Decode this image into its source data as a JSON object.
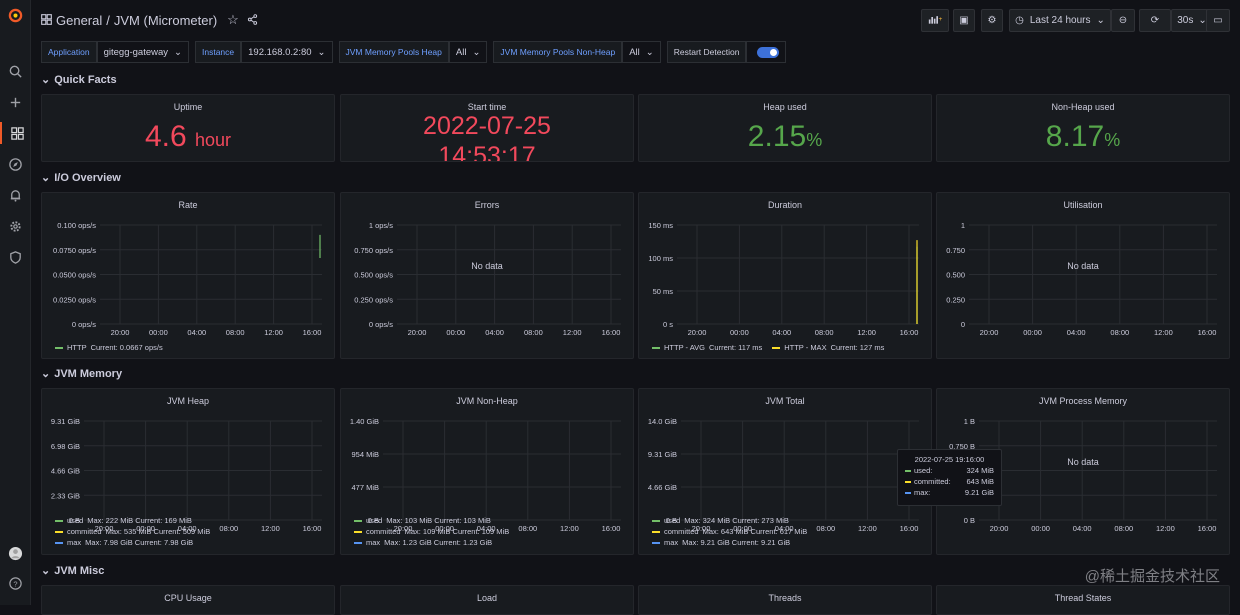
{
  "colors": {
    "green": "#73bf69",
    "yellow": "#fade2a",
    "cyan": "#5794f2",
    "red": "#f2495c",
    "stat_green": "#56a64b",
    "accent": "#f05a28"
  },
  "sidenav": {
    "items": [
      {
        "icon": "grafana-logo-icon"
      },
      {
        "icon": "search-icon"
      },
      {
        "icon": "plus-icon"
      },
      {
        "icon": "dashboards-icon",
        "active": true
      },
      {
        "icon": "explore-compass-icon"
      },
      {
        "icon": "alerting-bell-icon"
      },
      {
        "icon": "configuration-gear-icon"
      },
      {
        "icon": "shield-icon"
      },
      {
        "icon": "user-avatar-icon"
      },
      {
        "icon": "help-icon"
      }
    ]
  },
  "breadcrumb": {
    "folder": "General",
    "separator": "/",
    "dashboard": "JVM (Micrometer)"
  },
  "toolbar": {
    "time_range": "Last 24 hours",
    "refresh": "30s"
  },
  "variables": [
    {
      "label": "Application",
      "value": "gitegg-gateway",
      "dropdown": true
    },
    {
      "label": "Instance",
      "value": "192.168.0.2:80",
      "dropdown": true
    },
    {
      "label": "JVM Memory Pools Heap",
      "value": "All",
      "dropdown": true
    },
    {
      "label": "JVM Memory Pools Non-Heap",
      "value": "All",
      "dropdown": true
    },
    {
      "label": "Restart Detection",
      "value": "",
      "toggle": true
    }
  ],
  "rows": {
    "quick_facts": "Quick Facts",
    "io_overview": "I/O Overview",
    "jvm_memory": "JVM Memory",
    "jvm_misc": "JVM Misc"
  },
  "stats": {
    "uptime": {
      "title": "Uptime",
      "value": "4.6",
      "unit": "hour"
    },
    "start_time": {
      "title": "Start time",
      "line1": "2022-07-25",
      "line2": "14:53:17"
    },
    "heap_used": {
      "title": "Heap used",
      "value": "2.15",
      "unit": "%"
    },
    "nonheap_used": {
      "title": "Non-Heap used",
      "value": "8.17",
      "unit": "%"
    }
  },
  "x_ticks": [
    "20:00",
    "00:00",
    "04:00",
    "08:00",
    "12:00",
    "16:00"
  ],
  "no_data": "No data",
  "chart_data": [
    {
      "id": "rate",
      "type": "line",
      "title": "Rate",
      "y_ticks": [
        "0.100 ops/s",
        "0.0750 ops/s",
        "0.0500 ops/s",
        "0.0250 ops/s",
        "0 ops/s"
      ],
      "ylim": [
        0,
        0.1
      ],
      "series": [
        {
          "name": "HTTP",
          "color": "#73bf69",
          "values": [
            0.09,
            0.0667
          ],
          "legend": "Current: 0.0667 ops/s"
        }
      ]
    },
    {
      "id": "errors",
      "type": "line",
      "title": "Errors",
      "y_ticks": [
        "1 ops/s",
        "0.750 ops/s",
        "0.500 ops/s",
        "0.250 ops/s",
        "0 ops/s"
      ],
      "ylim": [
        0,
        1
      ],
      "series": []
    },
    {
      "id": "duration",
      "type": "line",
      "title": "Duration",
      "y_ticks": [
        "150 ms",
        "100 ms",
        "50 ms",
        "0 s"
      ],
      "ylim": [
        0,
        150
      ],
      "series": [
        {
          "name": "HTTP - AVG",
          "color": "#73bf69",
          "values": [
            0,
            117
          ],
          "legend": "Current: 117 ms"
        },
        {
          "name": "HTTP - MAX",
          "color": "#fade2a",
          "values": [
            0,
            127
          ],
          "legend": "Current: 127 ms"
        }
      ]
    },
    {
      "id": "utilisation",
      "type": "line",
      "title": "Utilisation",
      "y_ticks": [
        "1",
        "0.750",
        "0.500",
        "0.250",
        "0"
      ],
      "ylim": [
        0,
        1
      ],
      "series": []
    },
    {
      "id": "jvm_heap",
      "type": "line",
      "title": "JVM Heap",
      "y_ticks": [
        "9.31 GiB",
        "6.98 GiB",
        "4.66 GiB",
        "2.33 GiB",
        "0 B"
      ],
      "ylim": [
        0,
        9.31
      ],
      "series": [
        {
          "name": "used",
          "color": "#73bf69",
          "legend": "Max: 222 MiB  Current: 169 MiB"
        },
        {
          "name": "committed",
          "color": "#fade2a",
          "legend": "Max: 535 MiB  Current: 509 MiB"
        },
        {
          "name": "max",
          "color": "#5794f2",
          "values": [
            7.98,
            7.98
          ],
          "legend": "Max: 7.98 GiB  Current: 7.98 GiB"
        }
      ]
    },
    {
      "id": "jvm_nonheap",
      "type": "line",
      "title": "JVM Non-Heap",
      "y_ticks": [
        "1.40 GiB",
        "954 MiB",
        "477 MiB",
        "0 B"
      ],
      "ylim": [
        0,
        1.4
      ],
      "series": [
        {
          "name": "used",
          "color": "#73bf69",
          "legend": "Max: 103 MiB  Current: 103 MiB"
        },
        {
          "name": "committed",
          "color": "#fade2a",
          "legend": "Max: 109 MiB  Current: 109 MiB"
        },
        {
          "name": "max",
          "color": "#5794f2",
          "values": [
            1.23,
            1.23
          ],
          "legend": "Max: 1.23 GiB  Current: 1.23 GiB"
        }
      ]
    },
    {
      "id": "jvm_total",
      "type": "line",
      "title": "JVM Total",
      "y_ticks": [
        "14.0 GiB",
        "9.31 GiB",
        "4.66 GiB",
        "0 B"
      ],
      "ylim": [
        0,
        14
      ],
      "series": [
        {
          "name": "used",
          "color": "#73bf69",
          "legend": "Max: 324 MiB  Current: 273 MiB"
        },
        {
          "name": "committed",
          "color": "#fade2a",
          "legend": "Max: 643 MiB  Current: 617 MiB"
        },
        {
          "name": "max",
          "color": "#5794f2",
          "values": [
            9.21,
            9.21
          ],
          "legend": "Max: 9.21 GiB  Current: 9.21 GiB"
        }
      ]
    },
    {
      "id": "jvm_process_memory",
      "type": "line",
      "title": "JVM Process Memory",
      "y_ticks": [
        "1 B",
        "0.750 B",
        "0.500 B",
        "0.250 B",
        "0 B"
      ],
      "ylim": [
        0,
        1
      ],
      "series": []
    }
  ],
  "tooltip": {
    "time": "2022-07-25 19:16:00",
    "rows": [
      {
        "label": "used:",
        "value": "324 MiB",
        "color": "#73bf69"
      },
      {
        "label": "committed:",
        "value": "643 MiB",
        "color": "#fade2a"
      },
      {
        "label": "max:",
        "value": "9.21 GiB",
        "color": "#5794f2"
      }
    ]
  },
  "misc_panels": [
    "CPU Usage",
    "Load",
    "Threads",
    "Thread States"
  ],
  "watermark": "@稀土掘金技术社区"
}
